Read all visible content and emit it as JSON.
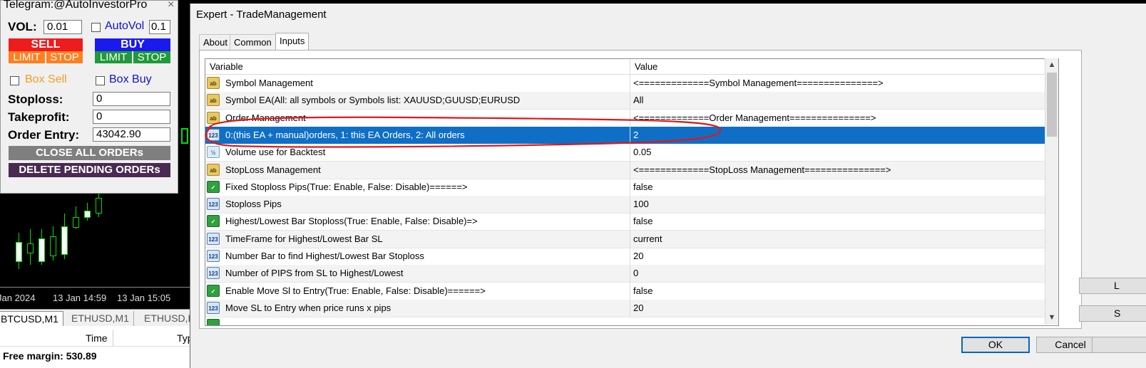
{
  "panel": {
    "title": "Telegram:@AutoInvestorPro",
    "close": "×",
    "vol_label": "VOL:",
    "vol_value": "0.01",
    "autovol_label": "AutoVol",
    "autovol_value": "0.1",
    "sell_label": "SELL",
    "sell_limit": "LIMIT",
    "sell_stop": "STOP",
    "buy_label": "BUY",
    "buy_limit": "LIMIT",
    "buy_stop": "STOP",
    "box_sell": "Box Sell",
    "box_buy": "Box Buy",
    "stoploss_label": "Stoploss:",
    "stoploss_value": "0",
    "takeprofit_label": "Takeprofit:",
    "takeprofit_value": "0",
    "order_entry_label": "Order Entry:",
    "order_entry_value": "43042.90",
    "close_all": "CLOSE ALL ORDERs",
    "delete_pending": "DELETE PENDING ORDERs"
  },
  "chart": {
    "x_labels": [
      "Jan 2024",
      "13 Jan 14:59",
      "13 Jan 15:05"
    ],
    "tabs": [
      "BTCUSD,M1",
      "ETHUSD,M1",
      "ETHUSD,H"
    ],
    "table_headers": [
      "Time",
      "Typ"
    ],
    "free_margin": "Free margin: 530.89"
  },
  "dialog": {
    "title": "Expert - TradeManagement",
    "tabs": [
      "About",
      "Common",
      "Inputs"
    ],
    "active_tab": "Inputs",
    "headers": {
      "variable": "Variable",
      "value": "Value"
    },
    "rows": [
      {
        "icon": "ab",
        "variable": "Symbol Management",
        "value": "<=============Symbol Management===============>"
      },
      {
        "icon": "ab",
        "variable": "Symbol EA(All: all symbols or Symbols list: XAUUSD;GUUSD;EURUSD",
        "value": "All"
      },
      {
        "icon": "ab",
        "variable": "Order Management",
        "value": "<=============Order Management===============>"
      },
      {
        "icon": "123",
        "variable": "0:(this EA + manual)orders, 1: this EA Orders, 2: All orders",
        "value": "2"
      },
      {
        "icon": "v2",
        "variable": "Volume use for Backtest",
        "value": "0.05"
      },
      {
        "icon": "ab",
        "variable": "StopLoss Management",
        "value": "<=============StopLoss Management===============>"
      },
      {
        "icon": "bool",
        "variable": "Fixed Stoploss Pips(True: Enable, False: Disable)======>",
        "value": "false"
      },
      {
        "icon": "123",
        "variable": "Stoploss Pips",
        "value": "100"
      },
      {
        "icon": "bool",
        "variable": "Highest/Lowest Bar Stoploss(True: Enable, False: Disable)=>",
        "value": "false"
      },
      {
        "icon": "123",
        "variable": "TimeFrame for Highest/Lowest Bar SL",
        "value": "current"
      },
      {
        "icon": "123",
        "variable": "Number Bar to find Highest/Lowest Bar Stoploss",
        "value": "20"
      },
      {
        "icon": "123",
        "variable": "Number of PIPS from SL to Highest/Lowest",
        "value": "0"
      },
      {
        "icon": "bool",
        "variable": "Enable Move Sl to Entry(True: Enable, False: Disable)======>",
        "value": "false"
      },
      {
        "icon": "123",
        "variable": "Move SL to Entry when price runs x pips",
        "value": "20"
      }
    ],
    "ok": "OK",
    "cancel": "Cancel",
    "side_btn_1": "L",
    "side_btn_2": "S"
  },
  "colors": {
    "selection": "#0f6fc6",
    "annotation": "#e01818",
    "sell": "#ee1c1c",
    "buy": "#1a1aee",
    "limit_stop_sell": "#ff7f1e",
    "limit_stop_buy": "#1e9a3a",
    "candle": "#00e000"
  }
}
